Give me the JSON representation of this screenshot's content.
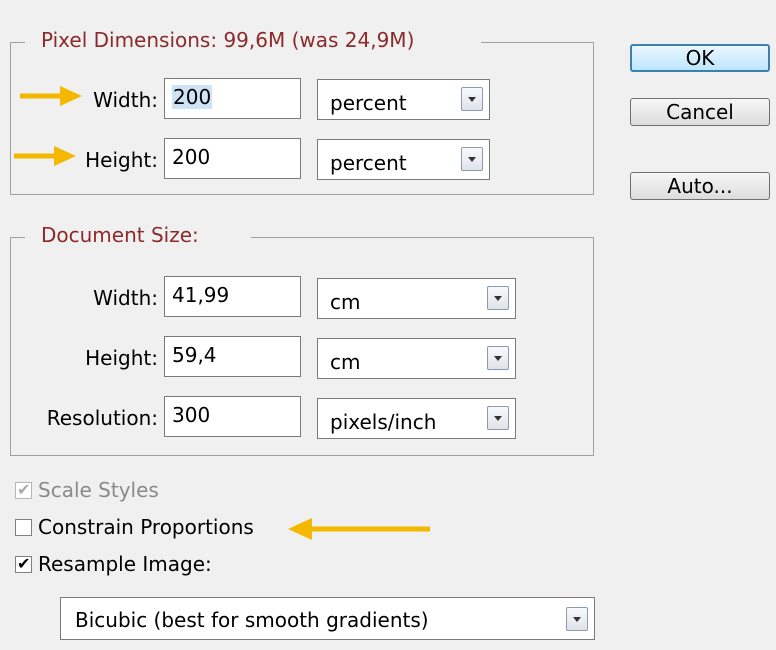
{
  "pixel_dimensions": {
    "legend": "Pixel Dimensions:  99,6M (was 24,9M)",
    "width": {
      "label": "Width:",
      "value": "200",
      "unit": "percent"
    },
    "height": {
      "label": "Height:",
      "value": "200",
      "unit": "percent"
    }
  },
  "document_size": {
    "legend": "Document Size:",
    "width": {
      "label": "Width:",
      "value": "41,99",
      "unit": "cm"
    },
    "height": {
      "label": "Height:",
      "value": "59,4",
      "unit": "cm"
    },
    "resolution": {
      "label": "Resolution:",
      "value": "300",
      "unit": "pixels/inch"
    }
  },
  "buttons": {
    "ok": "OK",
    "cancel": "Cancel",
    "auto": "Auto..."
  },
  "options": {
    "scale_styles": {
      "label": "Scale Styles",
      "checked": true,
      "disabled": true
    },
    "constrain_proportions": {
      "label": "Constrain Proportions",
      "checked": false
    },
    "resample_image": {
      "label": "Resample Image:",
      "checked": true
    }
  },
  "resample_method": "Bicubic (best for smooth gradients)",
  "colors": {
    "legend": "#8b2a2a",
    "arrow": "#f5b800"
  }
}
